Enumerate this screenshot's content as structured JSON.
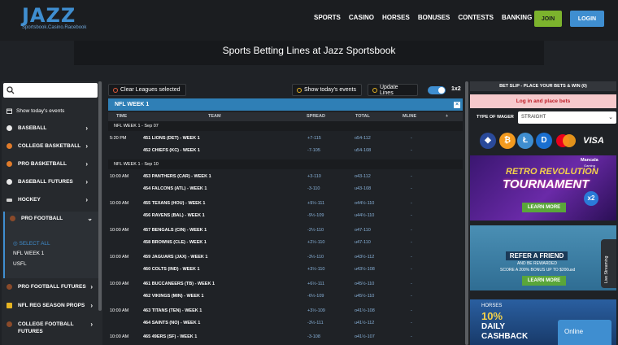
{
  "header": {
    "logo": "JAZZ",
    "logo_sub": "Sportsbook.Casino.Racebook",
    "nav": [
      "SPORTS",
      "CASINO",
      "HORSES",
      "BONUSES",
      "CONTESTS",
      "BANKING"
    ],
    "join": "JOIN",
    "login": "LOGIN"
  },
  "page_title": "Sports Betting Lines at Jazz Sportsbook",
  "sidebar": {
    "search_placeholder": "",
    "show_today": "Show today's events",
    "items": [
      {
        "label": "BASEBALL",
        "color": "#e8e8e8"
      },
      {
        "label": "COLLEGE BASKETBALL",
        "color": "#e07b2a"
      },
      {
        "label": "PRO BASKETBALL",
        "color": "#e07b2a"
      },
      {
        "label": "BASEBALL FUTURES",
        "color": "#e8e8e8"
      },
      {
        "label": "HOCKEY",
        "color": "#cfcfcf"
      },
      {
        "label": "PRO FOOTBALL",
        "color": "#8a4a2a"
      }
    ],
    "pro_football_subs": {
      "select_all": "SELECT ALL",
      "links": [
        "NFL WEEK 1",
        "USFL"
      ]
    },
    "items_after": [
      {
        "label": "PRO FOOTBALL FUTURES",
        "color": "#8a4a2a"
      },
      {
        "label": "NFL REG SEASON PROPS",
        "color": "#e6b422"
      },
      {
        "label": "COLLEGE FOOTBALL FUTURES",
        "color": "#8a4a2a"
      }
    ]
  },
  "toolbar": {
    "clear": "Clear Leagues selected",
    "show_today": "Show today's events",
    "update": "Update Lines",
    "x2": "1x2"
  },
  "table": {
    "league": "NFL WEEK 1",
    "close": "×",
    "headers": [
      "TIME",
      "TEAM",
      "SPREAD",
      "TOTAL",
      "MLINE",
      "+"
    ],
    "date1": "NFL WEEK 1 - Sep 07",
    "date2": "NFL WEEK 1 - Sep 10",
    "rows": [
      {
        "time": "5:20 PM",
        "team": "451  LIONS (DET) - WEEK 1",
        "spread": "+7-115",
        "total": "o54-112",
        "ml": "-"
      },
      {
        "time": "",
        "team": "452  CHIEFS (KC) - WEEK 1",
        "spread": "-7-105",
        "total": "u54-108",
        "ml": "-"
      },
      {
        "time": "10:00 AM",
        "team": "453  PANTHERS (CAR) - WEEK 1",
        "spread": "+3-110",
        "total": "o43-112",
        "ml": "-"
      },
      {
        "time": "",
        "team": "454  FALCONS (ATL) - WEEK 1",
        "spread": "-3-110",
        "total": "u43-108",
        "ml": "-"
      },
      {
        "time": "10:00 AM",
        "team": "455  TEXANS (HOU) - WEEK 1",
        "spread": "+9½-111",
        "total": "o44½-110",
        "ml": "-"
      },
      {
        "time": "",
        "team": "456  RAVENS (BAL) - WEEK 1",
        "spread": "-9½-109",
        "total": "u44½-110",
        "ml": "-"
      },
      {
        "time": "10:00 AM",
        "team": "457  BENGALS (CIN) - WEEK 1",
        "spread": "-2½-110",
        "total": "o47-110",
        "ml": "-"
      },
      {
        "time": "",
        "team": "458  BROWNS (CLE) - WEEK 1",
        "spread": "+2½-110",
        "total": "u47-110",
        "ml": "-"
      },
      {
        "time": "10:00 AM",
        "team": "459  JAGUARS (JAX) - WEEK 1",
        "spread": "-3½-110",
        "total": "o43½-112",
        "ml": "-"
      },
      {
        "time": "",
        "team": "460  COLTS (IND) - WEEK 1",
        "spread": "+3½-110",
        "total": "u43½-108",
        "ml": "-"
      },
      {
        "time": "10:00 AM",
        "team": "461  BUCCANEERS (TB) - WEEK 1",
        "spread": "+6½-111",
        "total": "o45½-110",
        "ml": "-"
      },
      {
        "time": "",
        "team": "462  VIKINGS (MIN) - WEEK 1",
        "spread": "-6½-109",
        "total": "u45½-110",
        "ml": "-"
      },
      {
        "time": "10:00 AM",
        "team": "463  TITANS (TEN) - WEEK 1",
        "spread": "+3½-109",
        "total": "o41½-108",
        "ml": "-"
      },
      {
        "time": "",
        "team": "464  SAINTS (NO) - WEEK 1",
        "spread": "-3½-111",
        "total": "u41½-112",
        "ml": "-"
      },
      {
        "time": "10:00 AM",
        "team": "465  49ERS (SF) - WEEK 1",
        "spread": "-3-108",
        "total": "o41½-107",
        "ml": "-"
      }
    ]
  },
  "betslip": {
    "head": "BET SLIP - PLACE YOUR BETS & WIN (0)",
    "login": "Log in and place bets",
    "wager_label": "TYPE OF WAGER",
    "wager_value": "STRAIGHT",
    "visa": "VISA"
  },
  "banners": {
    "b1_brand": "Mancala",
    "b1_brand_sub": "Gaming",
    "b1_line1": "RETRO REVOLUTION",
    "b1_line2": "TOURNAMENT",
    "b1_badge": "x2",
    "b1_cta": "LEARN MORE",
    "b2_line1": "REFER A FRIEND",
    "b2_line2": "AND BE REWARDED",
    "b2_line3": "SCORE A 200% BONUS UP TO $200usd",
    "b2_cta": "LEARN MORE",
    "b3_line1": "HORSES",
    "b3_line2": "10%",
    "b3_line3": "DAILY",
    "b3_line4": "CASHBACK"
  },
  "live_streaming": "Live Streaming",
  "online": "Online"
}
